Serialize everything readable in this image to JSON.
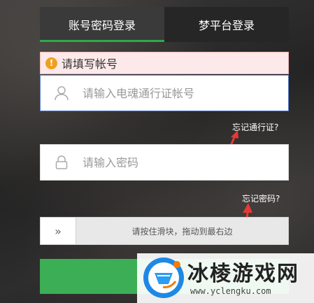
{
  "tabs": [
    {
      "label": "账号密码登录",
      "active": true
    },
    {
      "label": "梦平台登录",
      "active": false
    }
  ],
  "error": {
    "icon": "warning-icon",
    "text": "请填写帐号"
  },
  "account": {
    "placeholder": "请输入电魂通行证帐号",
    "icon": "user-icon"
  },
  "forgot_account": "忘记通行证?",
  "password": {
    "placeholder": "请输入密码",
    "icon": "lock-icon"
  },
  "forgot_password": "忘记密码?",
  "slider": {
    "handle": "»",
    "text": "请按住滑块，拖动到最右边"
  },
  "login_button": "",
  "watermark": {
    "title": "冰棱游戏网",
    "url": "www.yclengku.com"
  },
  "colors": {
    "accent": "#2eaa4a",
    "button": "#3cae55",
    "annotation": "#e53935",
    "error_bg": "#fde9e9"
  }
}
